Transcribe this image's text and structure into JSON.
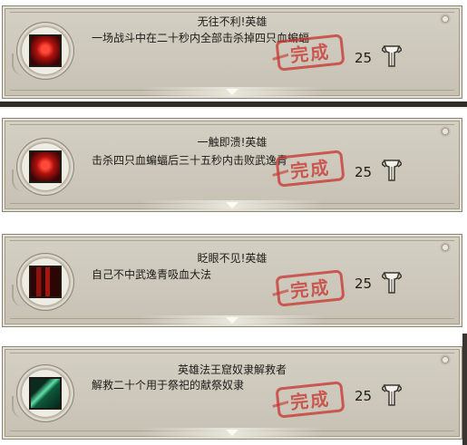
{
  "achievements": [
    {
      "title": "无往不利!英雄",
      "description": "一场战斗中在二十秒内全部击杀掉四只血蝙蝠",
      "points": "25",
      "stamp": "完成",
      "icon": "red-demon-face-icon"
    },
    {
      "title": "一触即溃!英雄",
      "description": "击杀四只血蝙蝠后三十五秒内击败武逸青",
      "points": "25",
      "stamp": "完成",
      "icon": "red-demon-face-icon"
    },
    {
      "title": "眨眼不见!英雄",
      "description": "自己不中武逸青吸血大法",
      "points": "25",
      "stamp": "完成",
      "icon": "blood-pillar-icon"
    },
    {
      "title": "英雄法王窟奴隶解救者",
      "description": "解救二十个用于祭祀的献祭奴隶",
      "points": "25",
      "stamp": "完成",
      "icon": "green-spear-icon"
    }
  ],
  "colors": {
    "stamp_red": "#c8322d",
    "card_bg": "#ccc8bb"
  }
}
